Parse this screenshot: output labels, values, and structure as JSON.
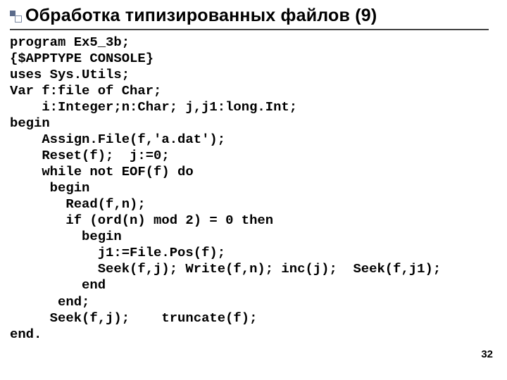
{
  "title": "Обработка типизированных файлов (9)",
  "code": "program Ex5_3b;\n{$APPTYPE CONSOLE}\nuses Sys.Utils;\nVar f:file of Char;\n    i:Integer;n:Char; j,j1:long.Int;\nbegin\n    Assign.File(f,'a.dat');\n    Reset(f);  j:=0;\n    while not EOF(f) do\n     begin\n       Read(f,n);\n       if (ord(n) mod 2) = 0 then\n         begin\n           j1:=File.Pos(f);\n           Seek(f,j); Write(f,n); inc(j);  Seek(f,j1);\n         end\n      end;\n     Seek(f,j);    truncate(f);\nend.",
  "page_number": "32"
}
